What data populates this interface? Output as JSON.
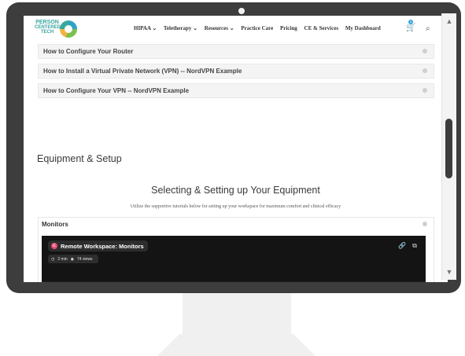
{
  "logo": {
    "line1": "PERSON",
    "line2": "CENTERED",
    "line3": "TECH"
  },
  "nav": {
    "items": [
      "HIPAA ⌄",
      "Teletherapy ⌄",
      "Resources ⌄",
      "Practice Care",
      "Pricing",
      "CE & Services",
      "My Dashboard"
    ],
    "cart_count": "0"
  },
  "accordion": [
    {
      "label": "How to Configure Your Router"
    },
    {
      "label": "How to Install a Virtual Private Network (VPN) -- NordVPN Example"
    },
    {
      "label": "How to Configure Your VPN -- NordVPN Example"
    }
  ],
  "section": {
    "title": "Equipment & Setup",
    "heading": "Selecting & Setting up Your Equipment",
    "subtitle": "Utilize the supportive tutorials below for setting up your workspace for maximum comfort and clinical efficacy"
  },
  "monitors": {
    "label": "Monitors",
    "video": {
      "avatar": "E",
      "title": "Remote Workspace: Monitors",
      "duration": "2 min",
      "views": "74 views"
    }
  },
  "icons": {
    "cart": "cart-icon",
    "search": "search-icon",
    "link": "link-icon",
    "external": "external-link-icon"
  },
  "colors": {
    "brand_teal": "#3aa6a0",
    "monitor_bezel": "#3d3d3d",
    "video_bg": "#141414",
    "avatar": "#e84a73"
  }
}
